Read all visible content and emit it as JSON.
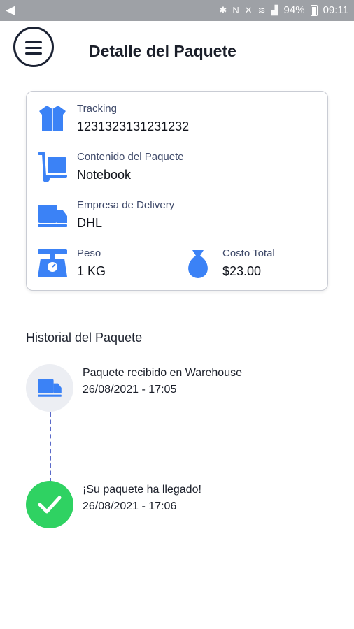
{
  "status_bar": {
    "battery_percent": "94%",
    "time": "09:11"
  },
  "header": {
    "title": "Detalle del Paquete"
  },
  "package": {
    "tracking": {
      "label": "Tracking",
      "value": "1231323131231232",
      "icon": "box-icon"
    },
    "contents": {
      "label": "Contenido del Paquete",
      "value": "Notebook",
      "icon": "hand-truck-icon"
    },
    "delivery": {
      "label": "Empresa de Delivery",
      "value": "DHL",
      "icon": "delivery-truck-icon"
    },
    "weight": {
      "label": "Peso",
      "value": "1 KG",
      "icon": "scale-icon"
    },
    "total": {
      "label": "Costo Total",
      "value": "$23.00",
      "icon": "money-bag-icon"
    }
  },
  "history": {
    "title": "Historial del Paquete",
    "events": [
      {
        "text": "Paquete recibido en Warehouse",
        "date": "26/08/2021 - 17:05",
        "icon": "delivery-truck-icon",
        "status": "pending"
      },
      {
        "text": "¡Su paquete ha llegado!",
        "date": "26/08/2021 - 17:06",
        "icon": "check-icon",
        "status": "done"
      }
    ]
  },
  "colors": {
    "accent": "#3b82f6",
    "success": "#2fd262",
    "status_bar": "#9ea1a6"
  }
}
